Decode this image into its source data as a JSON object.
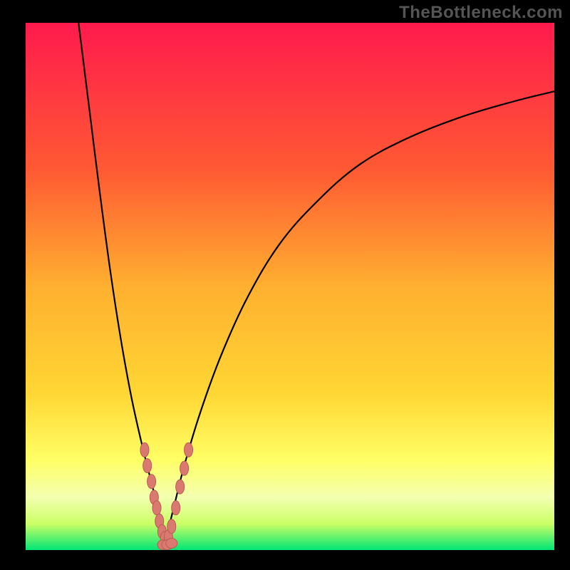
{
  "watermark": "TheBottleneck.com",
  "colors": {
    "bg_black": "#000000",
    "gradient_top": "#ff1a4d",
    "gradient_mid1": "#ff7a2a",
    "gradient_mid2": "#ffd633",
    "gradient_mid3": "#ffff66",
    "gradient_mid4": "#ccff66",
    "gradient_bottom": "#00e676",
    "curve": "#000000",
    "marker_fill": "#d9796f",
    "marker_stroke": "#b85c52"
  },
  "chart_data": {
    "type": "line",
    "title": "",
    "xlabel": "",
    "ylabel": "",
    "xlim": [
      0,
      100
    ],
    "ylim": [
      0,
      100
    ],
    "series": [
      {
        "name": "left-branch",
        "x": [
          10,
          12,
          14,
          16,
          18,
          20,
          22,
          24,
          25.5,
          26.5
        ],
        "y": [
          100,
          84,
          68,
          53,
          40,
          29,
          20,
          12,
          6,
          2
        ]
      },
      {
        "name": "right-branch",
        "x": [
          26.5,
          28,
          30,
          33,
          37,
          42,
          48,
          55,
          63,
          72,
          82,
          92,
          100
        ],
        "y": [
          2,
          8,
          16,
          26,
          37,
          48,
          58,
          66,
          73,
          78,
          82,
          85,
          87
        ]
      }
    ],
    "markers_left": [
      {
        "x": 22.5,
        "y": 19
      },
      {
        "x": 23.0,
        "y": 16
      },
      {
        "x": 23.8,
        "y": 13
      },
      {
        "x": 24.3,
        "y": 10
      },
      {
        "x": 24.8,
        "y": 8
      },
      {
        "x": 25.3,
        "y": 5.5
      },
      {
        "x": 25.8,
        "y": 3.5
      },
      {
        "x": 26.3,
        "y": 2.2
      }
    ],
    "markers_right": [
      {
        "x": 27.0,
        "y": 2.5
      },
      {
        "x": 27.6,
        "y": 4.5
      },
      {
        "x": 28.4,
        "y": 8
      },
      {
        "x": 29.2,
        "y": 12
      },
      {
        "x": 30.0,
        "y": 15.5
      },
      {
        "x": 30.8,
        "y": 19
      }
    ],
    "markers_bottom": [
      {
        "x": 26.0,
        "y": 1.0
      },
      {
        "x": 26.8,
        "y": 1.0
      },
      {
        "x": 27.6,
        "y": 1.3
      }
    ]
  }
}
